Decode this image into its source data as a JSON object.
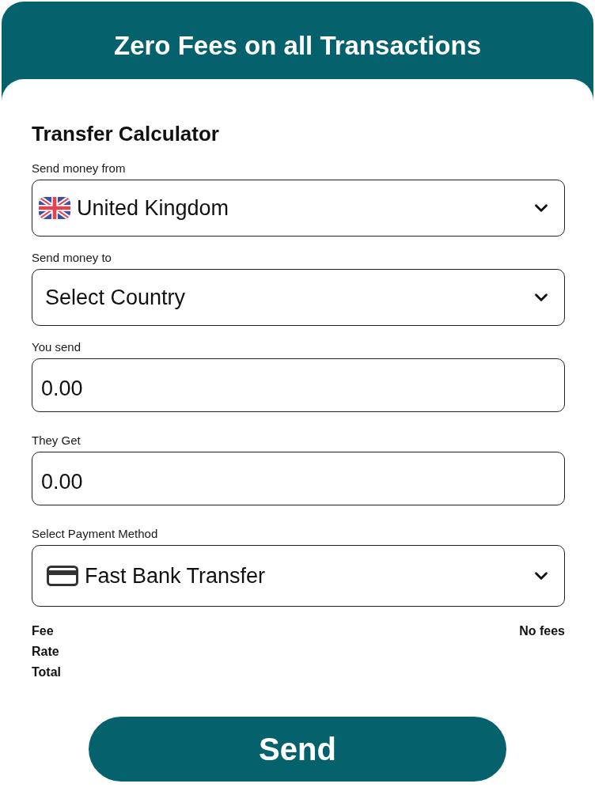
{
  "header": {
    "title": "Zero Fees on all Transactions"
  },
  "calculator": {
    "title": "Transfer Calculator",
    "fields": [
      {
        "kind": "country",
        "label": "Send money from",
        "value": "United Kingdom"
      },
      {
        "kind": "country",
        "label": "Send money to",
        "placeholder": "Select Country"
      },
      {
        "kind": "amount",
        "label": "You send",
        "value": "0.00"
      },
      {
        "kind": "amount",
        "label": "They Get",
        "value": "0.00"
      },
      {
        "kind": "method",
        "label": "Select Payment Method",
        "value": "Fast Bank Transfer"
      }
    ],
    "summary": [
      {
        "label": "Fee",
        "value": "No fees"
      },
      {
        "label": "Rate"
      },
      {
        "label": "Total"
      }
    ],
    "button": "Send"
  }
}
